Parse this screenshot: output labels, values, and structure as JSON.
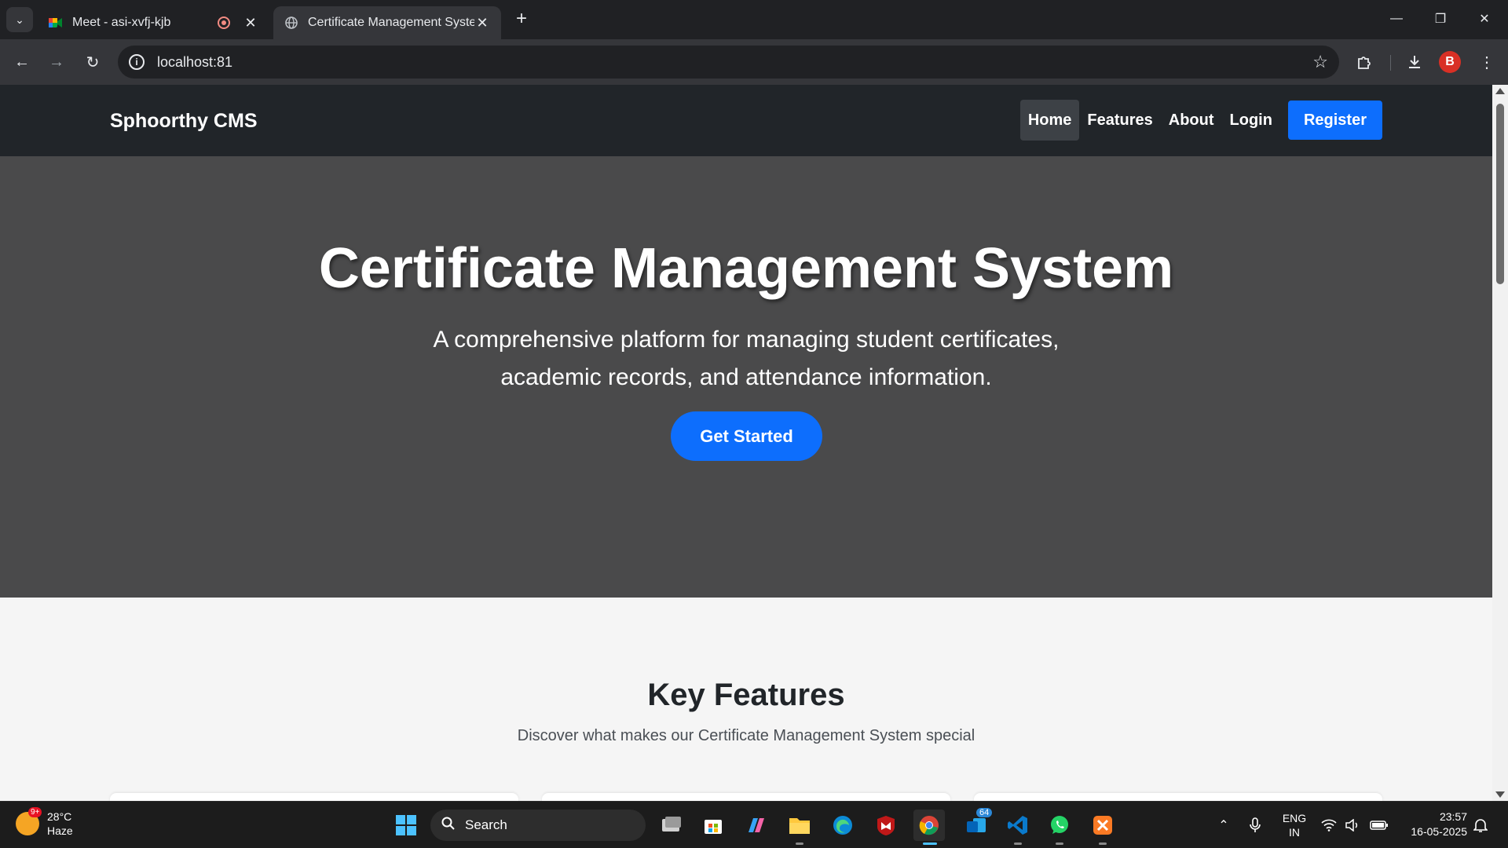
{
  "browser": {
    "tabs": [
      {
        "title": "Meet - asi-xvfj-kjb",
        "favicon": "google-meet-icon",
        "recording": true
      },
      {
        "title": "Certificate Management System",
        "favicon": "globe-icon",
        "active": true
      }
    ],
    "url": "localhost:81"
  },
  "site": {
    "brand": "Sphoorthy CMS",
    "nav": {
      "home": "Home",
      "features": "Features",
      "about": "About",
      "login": "Login",
      "register": "Register"
    },
    "hero": {
      "title": "Certificate Management System",
      "subtitle": "A comprehensive platform for managing student certificates, academic records, and attendance information.",
      "cta": "Get Started"
    },
    "features": {
      "title": "Key Features",
      "subtitle": "Discover what makes our Certificate Management System special"
    },
    "colors": {
      "navbar": "#212529",
      "hero": "#4a4a4b",
      "primary": "#0d6efd"
    }
  },
  "taskbar": {
    "weather": {
      "temp": "28°C",
      "condition": "Haze",
      "badge": "9+"
    },
    "search_label": "Search",
    "outlook_badge": "64",
    "language": "ENG",
    "region": "IN",
    "time": "23:57",
    "date": "16-05-2025"
  }
}
